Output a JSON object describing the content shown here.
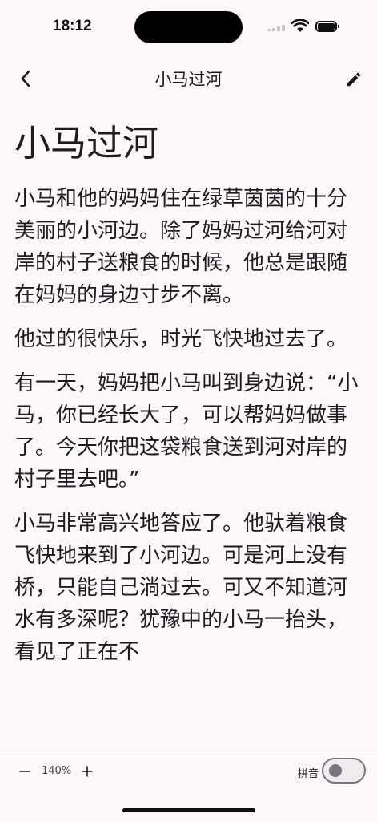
{
  "status_bar": {
    "time": "18:12",
    "icons": [
      "signal-icon",
      "wifi-icon",
      "battery-icon"
    ]
  },
  "app_bar": {
    "title": "小马过河",
    "back_icon": "chevron-left-icon",
    "edit_icon": "pencil-icon"
  },
  "story": {
    "title": "小马过河",
    "paragraphs": [
      "小马和他的妈妈住在绿草茵茵的十分美丽的小河边。除了妈妈过河给河对岸的村子送粮食的时候，他总是跟随在妈妈的身边寸步不离。",
      "他过的很快乐，时光飞快地过去了。",
      "有一天，妈妈把小马叫到身边说：“小马，你已经长大了，可以帮妈妈做事了。今天你把这袋粮食送到河对岸的村子里去吧。”",
      "小马非常高兴地答应了。他驮着粮食飞快地来到了小河边。可是河上没有桥，只能自己淌过去。可又不知道河水有多深呢？犹豫中的小马一抬头，看见了正在不"
    ]
  },
  "bottom_bar": {
    "zoom_out_label": "−",
    "zoom_level": "140%",
    "zoom_in_label": "+",
    "pinyin_label": "拼音",
    "pinyin_enabled": false
  },
  "colors": {
    "background": "#fdf7fa",
    "text": "#1c1b1f",
    "toggle_outline": "#79747e"
  }
}
